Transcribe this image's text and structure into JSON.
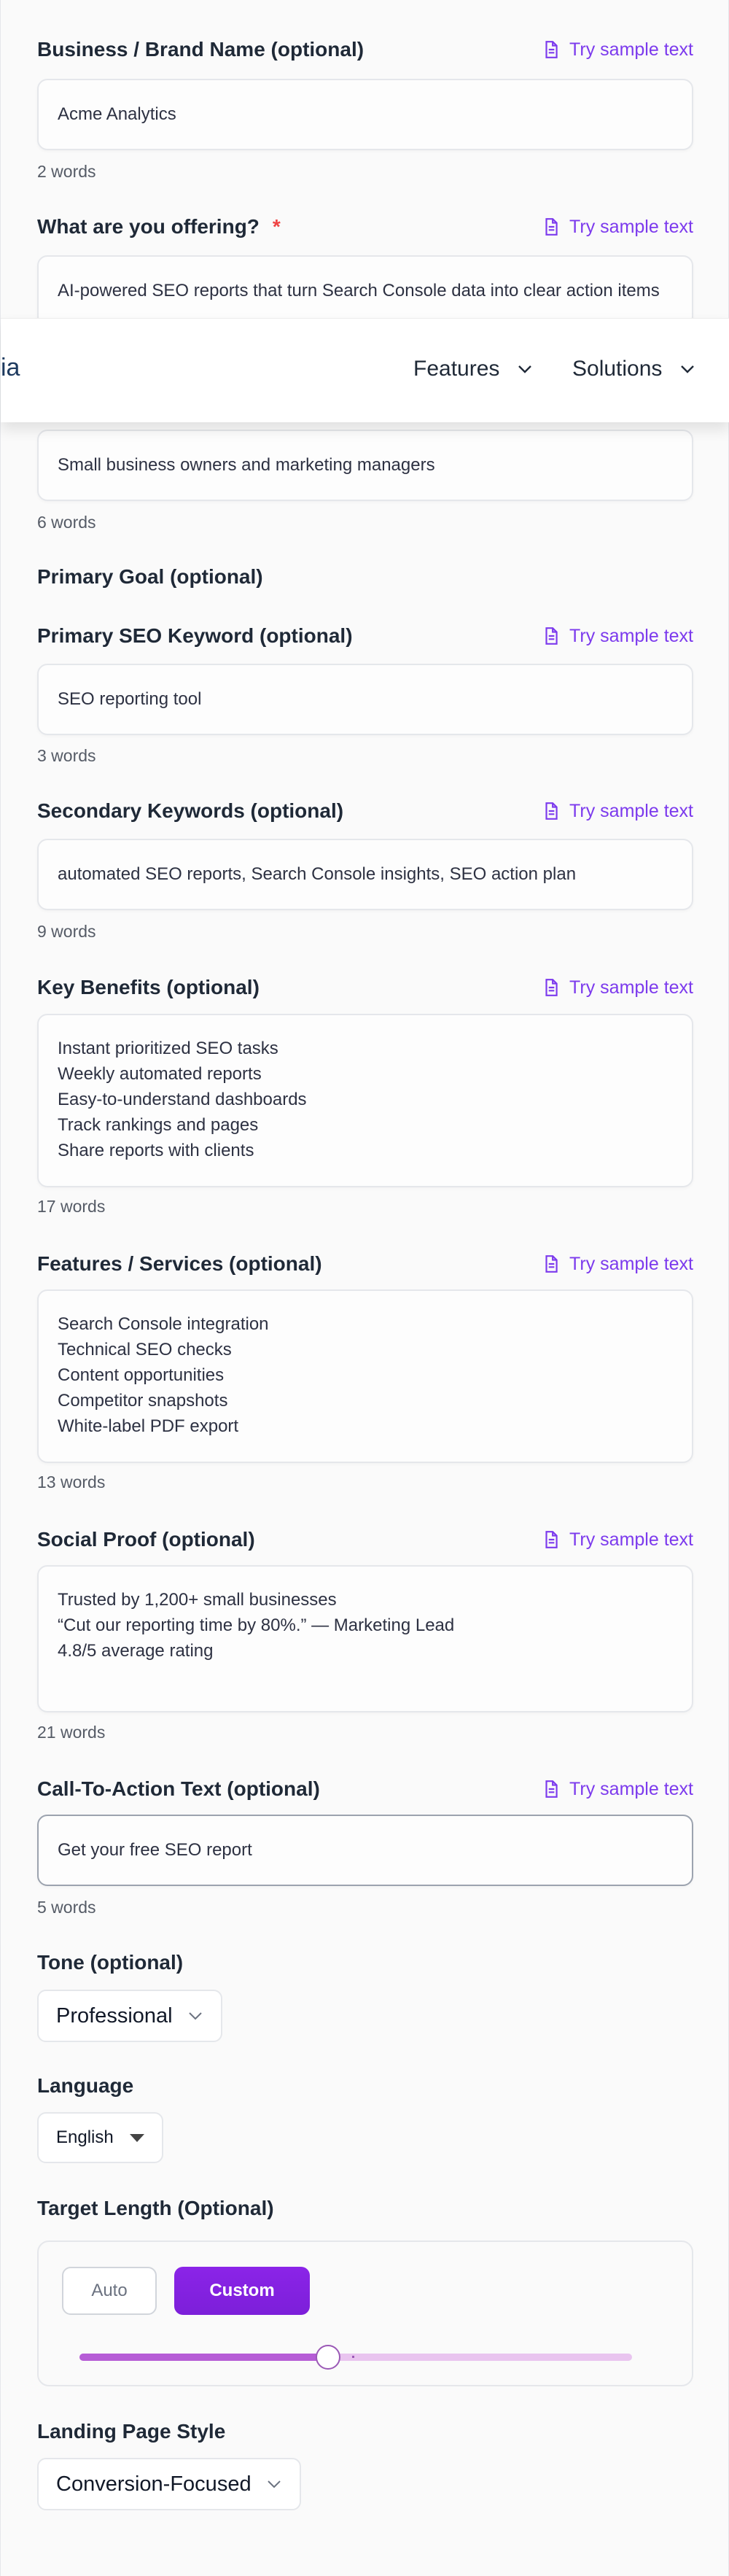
{
  "nav": {
    "logo_fragment": "ia",
    "items": [
      {
        "label": "Features"
      },
      {
        "label": "Solutions"
      }
    ]
  },
  "sample_label": "Try sample text",
  "fields": {
    "brand": {
      "label": "Business / Brand Name (optional)",
      "value": "Acme Analytics",
      "count": "2 words"
    },
    "offering": {
      "label": "What are you offering?",
      "required_mark": "*",
      "value": "AI-powered SEO reports that turn Search Console data into clear action items"
    },
    "audience": {
      "value": "Small business owners and marketing managers",
      "count": "6 words"
    },
    "goal": {
      "label": "Primary Goal (optional)"
    },
    "primary_kw": {
      "label": "Primary SEO Keyword (optional)",
      "value": "SEO reporting tool",
      "count": "3 words"
    },
    "secondary_kw": {
      "label": "Secondary Keywords (optional)",
      "value": "automated SEO reports, Search Console insights, SEO action plan",
      "count": "9 words"
    },
    "benefits": {
      "label": "Key Benefits (optional)",
      "lines": [
        "Instant prioritized SEO tasks",
        "Weekly automated reports",
        "Easy-to-understand dashboards",
        "Track rankings and pages",
        "Share reports with clients"
      ],
      "count": "17 words"
    },
    "features": {
      "label": "Features / Services (optional)",
      "lines": [
        "Search Console integration",
        "Technical SEO checks",
        "Content opportunities",
        "Competitor snapshots",
        "White-label PDF export"
      ],
      "count": "13 words"
    },
    "social": {
      "label": "Social Proof (optional)",
      "lines": [
        "Trusted by 1,200+ small businesses",
        "“Cut our reporting time by 80%.” — Marketing Lead",
        "4.8/5 average rating"
      ],
      "count": "21 words"
    },
    "cta": {
      "label": "Call-To-Action Text (optional)",
      "value": "Get your free SEO report",
      "count": "5 words"
    },
    "tone": {
      "label": "Tone (optional)",
      "value": "Professional"
    },
    "language": {
      "label": "Language",
      "value": "English"
    },
    "length": {
      "label": "Target Length (Optional)",
      "auto_label": "Auto",
      "custom_label": "Custom",
      "slider_fraction": 0.45
    },
    "style": {
      "label": "Landing Page Style",
      "value": "Conversion-Focused"
    }
  },
  "colors": {
    "accent": "#7c3aed",
    "required": "#ef4444",
    "custom_button": "#7e22ce"
  },
  "icons": {
    "sample": "document-icon",
    "dropdown": "chevron-down-icon"
  }
}
